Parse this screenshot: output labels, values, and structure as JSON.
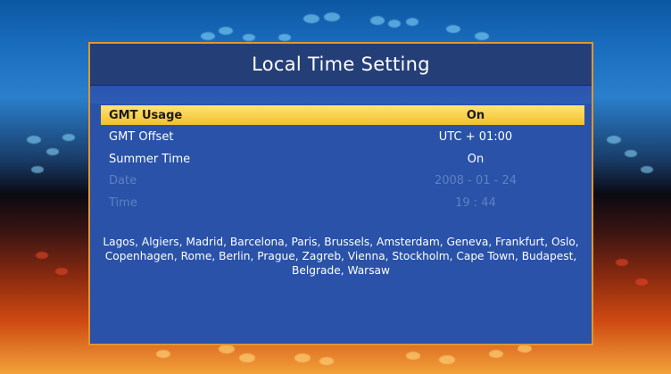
{
  "window": {
    "title": "Local Time Setting"
  },
  "settings": [
    {
      "label": "GMT Usage",
      "value": "On",
      "state": "selected"
    },
    {
      "label": "GMT Offset",
      "value": "UTC + 01:00",
      "state": "normal"
    },
    {
      "label": "Summer Time",
      "value": "On",
      "state": "normal"
    },
    {
      "label": "Date",
      "value": "2008 - 01 - 24",
      "state": "disabled"
    },
    {
      "label": "Time",
      "value": "19 : 44",
      "state": "disabled"
    }
  ],
  "timezone_cities": "Lagos, Algiers, Madrid, Barcelona, Paris, Brussels, Amsterdam, Geneva, Frankfurt, Oslo, Copenhagen, Rome, Berlin, Prague, Zagreb, Vienna, Stockholm, Cape Town, Budapest, Belgrade, Warsaw",
  "colors": {
    "panel_bg": "#2952a8",
    "title_bg": "#243f78",
    "panel_border": "#e0962e",
    "highlight": "#f2c02a",
    "disabled_text": "#5f80c4"
  }
}
